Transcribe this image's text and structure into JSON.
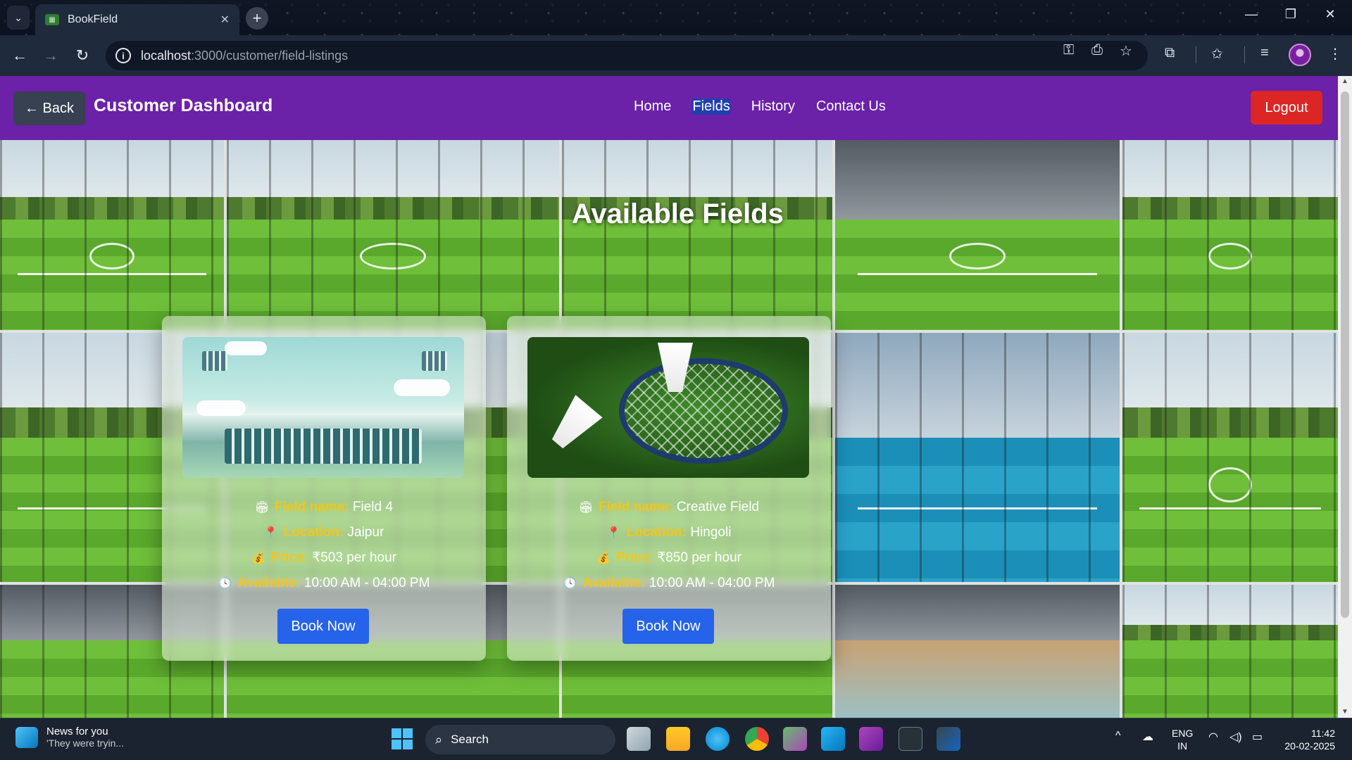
{
  "browser": {
    "tab_title": "BookField",
    "tab_favicon": "bookfield-favicon",
    "url_host": "localhost",
    "url_path": ":3000/customer/field-listings"
  },
  "navbar": {
    "back_label": "← Back",
    "title": "Customer Dashboard",
    "links": [
      "Home",
      "Fields",
      "History",
      "Contact Us"
    ],
    "active_link": "Fields",
    "logout_label": "Logout",
    "bg_color": "#6b21a8",
    "logout_color": "#dc2626"
  },
  "hero": {
    "title": "Available Fields"
  },
  "fields": [
    {
      "name_label": "Field name:",
      "name": "Field 4",
      "location_label": "Location:",
      "location": "Jaipur",
      "price_label": "Price:",
      "price": "₹503 per hour",
      "available_label": "Available:",
      "available": "10:00 AM - 04:00 PM",
      "book_label": "Book Now",
      "image": "stadium-illustration"
    },
    {
      "name_label": "Field name:",
      "name": "Creative Field",
      "location_label": "Location:",
      "location": "Hingoli",
      "price_label": "Price:",
      "price": "₹850 per hour",
      "available_label": "Available:",
      "available": "10:00 AM - 04:00 PM",
      "book_label": "Book Now",
      "image": "badminton-racket-shuttlecock"
    }
  ],
  "taskbar": {
    "news_title": "News for you",
    "news_subtitle": "'They were tryin...",
    "search_label": "Search",
    "lang_line1": "ENG",
    "lang_line2": "IN",
    "time": "11:42",
    "date": "20-02-2025"
  },
  "colors": {
    "book_button": "#2563eb",
    "label_accent": "#f5c518"
  }
}
